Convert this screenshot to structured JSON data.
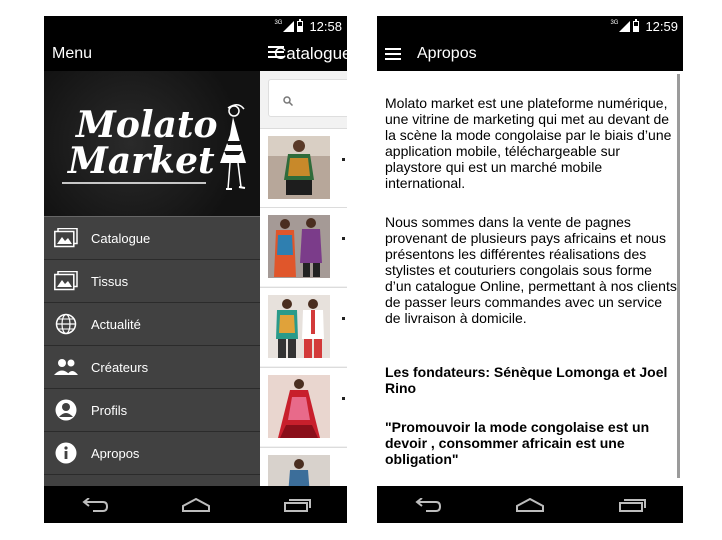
{
  "left_phone": {
    "status": {
      "time": "12:58",
      "network": "3G"
    },
    "menu_header": {
      "title": "Menu"
    },
    "catalog_header": {
      "title": "Catalogue"
    },
    "logo": {
      "line1": "Molato",
      "line2": "Market"
    },
    "drawer_items": [
      {
        "label": "Catalogue",
        "icon": "gallery-icon"
      },
      {
        "label": "Tissus",
        "icon": "gallery-icon"
      },
      {
        "label": "Actualité",
        "icon": "globe-icon"
      },
      {
        "label": "Créateurs",
        "icon": "people-icon"
      },
      {
        "label": "Profils",
        "icon": "person-icon"
      },
      {
        "label": "Apropos",
        "icon": "info-icon"
      }
    ]
  },
  "right_phone": {
    "status": {
      "time": "12:59",
      "network": "3G"
    },
    "header": {
      "title": "Apropos"
    },
    "content": {
      "paragraph1": "Molato market est une plateforme numérique, une vitrine de marketing qui met au devant de la scène la mode congolaise par le biais d’une application mobile, téléchargeable sur playstore qui est un marché mobile international.",
      "paragraph2": "Nous sommes dans la vente de pagnes provenant de plusieurs pays africains et nous présentons les différentes réalisations des stylistes et couturiers congolais sous forme d’un catalogue Online, permettant à nos clients de passer leurs commandes avec un service de livraison à domicile.",
      "founders": "Les fondateurs: Sénèque Lomonga et Joel Rino",
      "slogan": "\"Promouvoir la mode congolaise est un devoir , consommer africain est une obligation\""
    }
  },
  "colors": {
    "bar_black": "#000000",
    "drawer_bg": "#414141",
    "drawer_header_bg": "#151515",
    "text_white": "#ffffff"
  }
}
